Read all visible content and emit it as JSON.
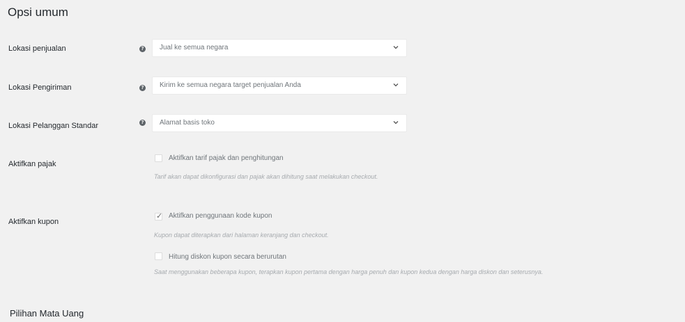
{
  "general": {
    "title": "Opsi umum"
  },
  "selling_location": {
    "label": "Lokasi penjualan",
    "value": "Jual ke semua negara"
  },
  "shipping_location": {
    "label": "Lokasi Pengiriman",
    "value": "Kirim ke semua negara target penjualan Anda"
  },
  "default_customer_location": {
    "label": "Lokasi Pelanggan Standar",
    "value": "Alamat basis toko"
  },
  "taxes": {
    "label": "Aktifkan pajak",
    "checkbox_label": "Aktifkan tarif pajak dan penghitungan",
    "checked": false,
    "description": "Tarif akan dapat dikonfigurasi dan pajak akan dihitung saat melakukan checkout."
  },
  "coupons": {
    "label": "Aktifkan kupon",
    "enable_label": "Aktifkan penggunaan kode kupon",
    "enable_checked": true,
    "enable_description": "Kupon dapat diterapkan dari halaman keranjang dan checkout.",
    "sequential_label": "Hitung diskon kupon secara berurutan",
    "sequential_checked": false,
    "sequential_description": "Saat menggunakan beberapa kupon, terapkan kupon pertama dengan harga penuh dan kupon kedua dengan harga diskon dan seterusnya."
  },
  "currency": {
    "title": "Pilihan Mata Uang"
  },
  "icons": {
    "help": "help-circle-icon",
    "chevron": "chevron-down-icon",
    "check": "checkmark-icon"
  }
}
